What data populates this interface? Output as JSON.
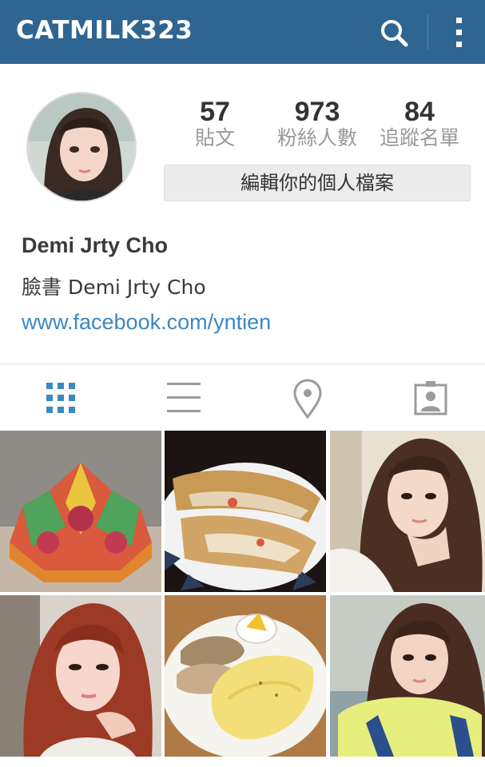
{
  "topbar": {
    "title": "CATMILK323",
    "search_icon": "search-icon",
    "more_icon": "more-vertical-icon",
    "background": "#2f6591"
  },
  "profile": {
    "avatar": "avatar",
    "stats": [
      {
        "value": "57",
        "label": "貼文"
      },
      {
        "value": "973",
        "label": "粉絲人數"
      },
      {
        "value": "84",
        "label": "追蹤名單"
      }
    ],
    "edit_button_label": "編輯你的個人檔案",
    "name": "Demi Jrty Cho",
    "bio": "臉書 Demi Jrty Cho",
    "link": "www.facebook.com/yntien",
    "link_color": "#3c88c0"
  },
  "tabs": [
    {
      "name": "grid-view-icon",
      "active": true
    },
    {
      "name": "list-view-icon",
      "active": false
    },
    {
      "name": "location-pin-icon",
      "active": false
    },
    {
      "name": "tagged-photos-icon",
      "active": false
    }
  ],
  "posts": [
    {
      "name": "post-origami-lotus"
    },
    {
      "name": "post-fried-pastry"
    },
    {
      "name": "post-selfie-hand-chin"
    },
    {
      "name": "post-selfie-red-hair"
    },
    {
      "name": "post-omelette-breakfast"
    },
    {
      "name": "post-selfie-backpack"
    }
  ]
}
